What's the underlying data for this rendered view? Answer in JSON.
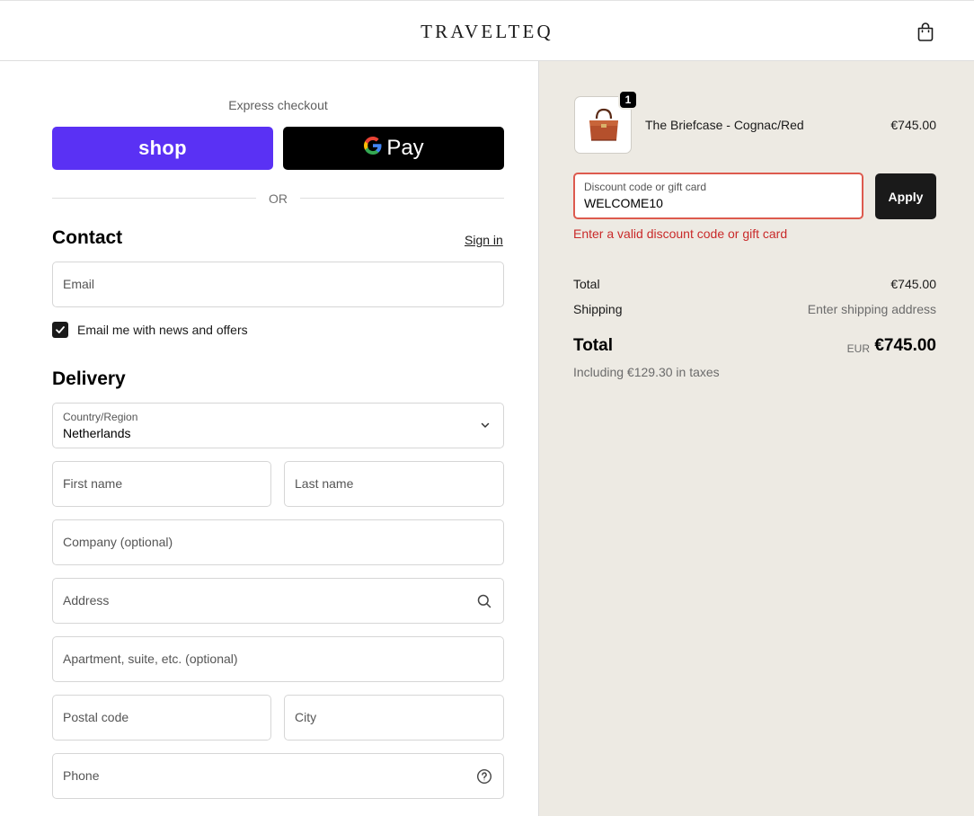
{
  "header": {
    "logo": "TRAVELTEQ",
    "cart_icon": "shopping-bag-icon"
  },
  "express": {
    "label": "Express checkout",
    "shop_pay_label": "shop",
    "google_pay_g": "G",
    "google_pay_label": "Pay",
    "or_label": "OR"
  },
  "contact": {
    "title": "Contact",
    "sign_in": "Sign in",
    "email_placeholder": "Email",
    "newsletter_label": "Email me with news and offers",
    "newsletter_checked": true
  },
  "delivery": {
    "title": "Delivery",
    "country_label": "Country/Region",
    "country_value": "Netherlands",
    "first_name_placeholder": "First name",
    "last_name_placeholder": "Last name",
    "company_placeholder": "Company (optional)",
    "address_placeholder": "Address",
    "apartment_placeholder": "Apartment, suite, etc. (optional)",
    "postal_placeholder": "Postal code",
    "city_placeholder": "City",
    "phone_placeholder": "Phone"
  },
  "summary": {
    "item": {
      "quantity": "1",
      "name": "The Briefcase - Cognac/Red",
      "price": "€745.00"
    },
    "discount": {
      "label": "Discount code or gift card",
      "value": "WELCOME10",
      "apply_label": "Apply",
      "error": "Enter a valid discount code or gift card"
    },
    "subtotal_label": "Total",
    "subtotal_value": "€745.00",
    "shipping_label": "Shipping",
    "shipping_value": "Enter shipping address",
    "total_label": "Total",
    "total_currency": "EUR",
    "total_value": "€745.00",
    "tax_note": "Including €129.30 in taxes"
  },
  "colors": {
    "shop_pay": "#5a31f4",
    "google_pay": "#000000",
    "summary_bg": "#edeae3",
    "error": "#c92a2a",
    "error_border": "#dd5a4e"
  }
}
